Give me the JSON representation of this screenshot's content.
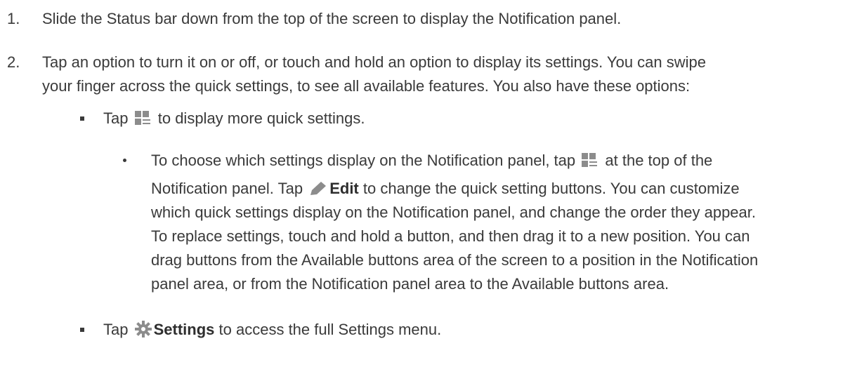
{
  "steps": [
    {
      "num": "1.",
      "text": "Slide the Status bar down from the top of the screen to display the Notification panel."
    },
    {
      "num": "2.",
      "line1": "Tap an option to turn it on or off, or touch and hold an option to display its settings. You can swipe",
      "line2": "your finger across the quick settings, to see all available features. You also have these options:"
    }
  ],
  "bullets": {
    "more": {
      "pre": "Tap",
      "post": "to display more quick settings."
    },
    "sub": {
      "line1_pre": "To choose which settings display on the Notification panel, tap",
      "line1_post": "at the top of the",
      "line2_pre": "Notification panel. Tap",
      "line2_bold": "Edit",
      "line2_post": "to change the quick setting buttons. You can customize",
      "line3": "which quick settings display on the Notification panel, and change the order they appear.",
      "line4": "To replace settings, touch and hold a button, and then drag it to a new position. You can",
      "line5": "drag buttons from the Available buttons area of the screen to a position in the Notification",
      "line6": "panel area, or from the Notification panel area to the Available buttons area."
    },
    "settings": {
      "pre": "Tap",
      "bold": "Settings",
      "post": "to access the full Settings menu."
    }
  },
  "icons": [
    "quick-settings-icon",
    "pencil-icon",
    "gear-icon"
  ],
  "colors": {
    "text": "#3a3a3a",
    "icon": "#8c8c8c"
  }
}
